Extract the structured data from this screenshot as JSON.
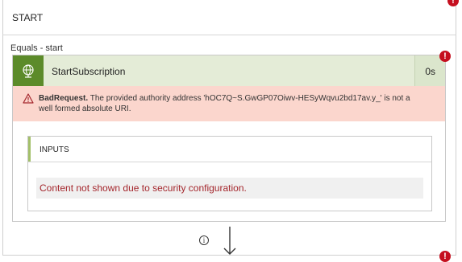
{
  "outer_block": {
    "title": "START",
    "error_badge": "!"
  },
  "case": {
    "label": "Equals - start"
  },
  "action": {
    "name": "StartSubscription",
    "duration": "0s",
    "error_badge": "!",
    "icon": "globe-icon"
  },
  "error": {
    "code": "BadRequest.",
    "message": " The provided authority address 'hOC7Q~S.GwGP07Oiwv-HESyWqvu2bd17av.y_' is not a well formed absolute URI."
  },
  "inputs": {
    "title": "INPUTS",
    "body": "Content not shown due to security configuration."
  },
  "connector": {
    "info_icon": "info-icon",
    "arrow": "down-arrow-icon",
    "bottom_badge": "!"
  },
  "colors": {
    "action_accent": "#5c8b2a",
    "action_header_bg": "#e4ecd7",
    "error_bg": "#fbd6cd",
    "error_badge": "#c50f1f",
    "security_text": "#a4262c"
  }
}
